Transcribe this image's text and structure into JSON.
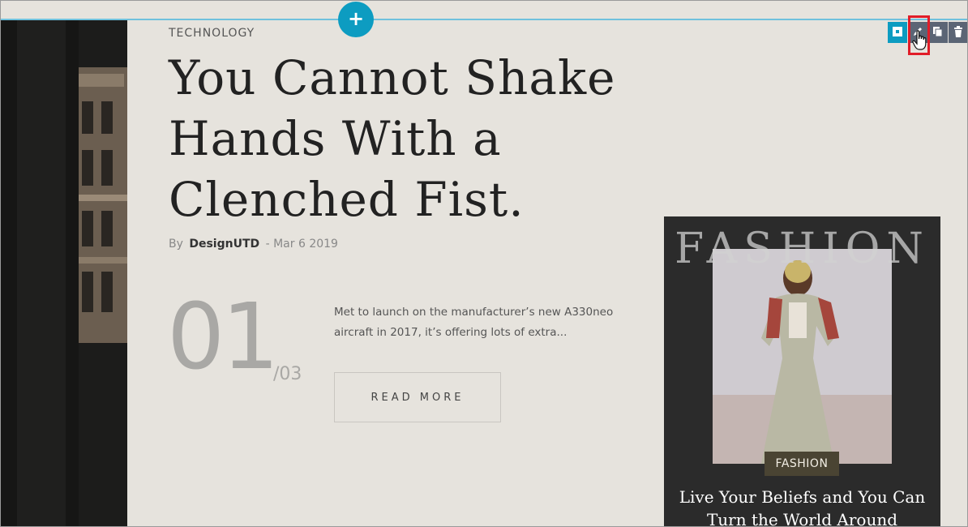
{
  "builder": {
    "add_label": "+",
    "toolbar": [
      {
        "name": "select",
        "icon": "select-icon"
      },
      {
        "name": "edit",
        "icon": "pencil-icon"
      },
      {
        "name": "duplicate",
        "icon": "copy-icon"
      },
      {
        "name": "delete",
        "icon": "trash-icon"
      }
    ],
    "colors": {
      "accent": "#0d9cc1",
      "toolbar": "#5b6575",
      "highlight": "#e11d28"
    }
  },
  "post": {
    "category": "TECHNOLOGY",
    "title": "You Cannot Shake Hands With a Clenched Fist.",
    "by_label": "By",
    "author": "DesignUTD",
    "separator": "-",
    "date": "Mar 6 2019",
    "slide_current": "01",
    "slide_total": "/03",
    "excerpt": "Met to launch on the manufacturer’s new A330neo aircraft in 2017, it’s offering lots of extra...",
    "read_more": "READ MORE"
  },
  "side_card": {
    "overlay_word": "FASHION",
    "badge": "FASHION",
    "title": "Live Your Beliefs and You Can Turn the World Around"
  }
}
